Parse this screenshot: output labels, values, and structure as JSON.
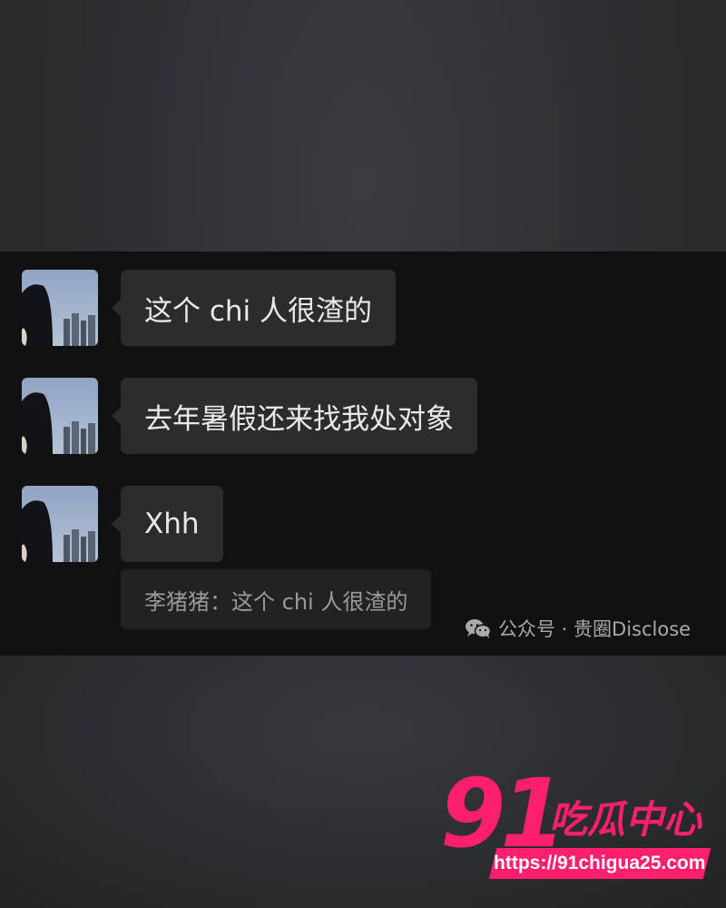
{
  "chat": {
    "messages": [
      {
        "text": "这个 chi 人很渣的"
      },
      {
        "text": "去年暑假还来找我处对象"
      },
      {
        "text": "Xhh"
      }
    ],
    "quote": {
      "text": "李猪猪：这个 chi 人很渣的"
    },
    "watermark": {
      "icon": "wechat-icon",
      "text": "公众号 · 贵圈Disclose"
    }
  },
  "logo": {
    "number": "91",
    "name": "吃瓜中心",
    "url": "https://91chigua25.com",
    "color": "#ff1f6e"
  },
  "colors": {
    "chat_background": "#111111",
    "bubble": "#2c2c2c",
    "quote_box": "#222222"
  }
}
